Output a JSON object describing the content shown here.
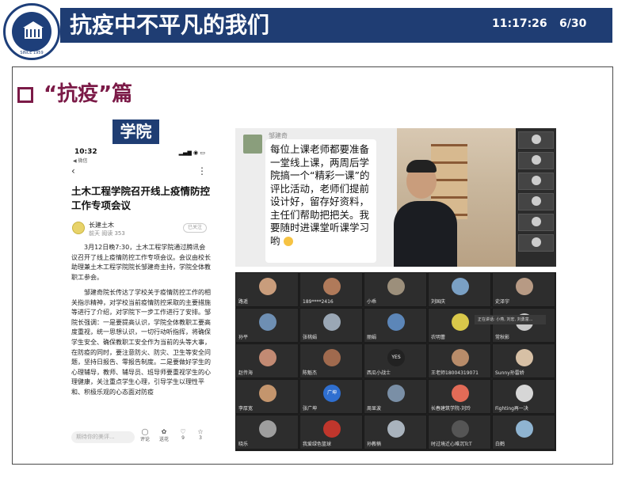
{
  "header": {
    "title": "抗疫中不平凡的我们",
    "time": "11:17:26",
    "page": "6/30"
  },
  "logo": {
    "label": "SINCE 1959"
  },
  "section": {
    "title": "“抗疫”篇"
  },
  "tag": {
    "label": "学院"
  },
  "phone": {
    "time": "10:32",
    "carrier": "◀ 微信",
    "back": "‹",
    "more": "⋮",
    "article_title": "土木工程学院召开线上疫情防控工作专项会议",
    "account_name": "长建土木",
    "account_meta": "前天  阅读 353",
    "follow_label": "已关注",
    "paragraph1": "3月12日晚7:30，土木工程学院通过腾讯会议召开了线上疫情防控工作专项会议。会议由校长助理兼土木工程学院院长邹建奇主持，学院全体教职工参会。",
    "paragraph2": "邹建奇院长传达了学校关于疫情防控工作的相关指示精神，对学校当前疫情防控采取的主要措施等进行了介绍，对学院下一步工作进行了安排。邹院长强调：一是要提高认识，学院全体教职工要高度重视，统一思想认识，一切行动听指挥，将确保学生安全、确保教职工安全作为当前的头等大事，在防疫的同时，要注意防火、防灾、卫生等安全问题，坚持日报告、零报告制度。二是要做好学生的心理辅导，教师、辅导员、班导师要重视学生的心理健康，关注重点学生心理，引导学生以理性平和、积极乐观的心态面对防疫",
    "comment_placeholder": "期待你的美评...",
    "actions": [
      {
        "icon": "◯",
        "label": "评论"
      },
      {
        "icon": "✿",
        "label": "送花"
      },
      {
        "icon": "♡",
        "label": "9"
      },
      {
        "icon": "☆",
        "label": "3"
      }
    ]
  },
  "chat": {
    "sender": "邹建奇",
    "message": "每位上课老师都要准备一堂线上课，两周后学院搞一个“精彩一课”的评比活动，老师们提前设计好，留存好资料，主任们帮助把把关。我要随时进课堂听课学习哟"
  },
  "meeting": {
    "popup": "正在讲话: 小燕, 刘宏, 刘勇富...",
    "participants": [
      {
        "name": "路遥",
        "avatar": "#c99d7c",
        "label": ""
      },
      {
        "name": "189****2416",
        "avatar": "#b07a5a",
        "label": ""
      },
      {
        "name": "小乖",
        "avatar": "#9c8f7b",
        "label": ""
      },
      {
        "name": "刘国庆",
        "avatar": "#7aa0c4",
        "label": ""
      },
      {
        "name": "史泽宇",
        "avatar": "#b79a84",
        "label": ""
      },
      {
        "name": "孙平",
        "avatar": "#6e8fb3",
        "label": ""
      },
      {
        "name": "张桃娟",
        "avatar": "#9aa7b5",
        "label": ""
      },
      {
        "name": "丽娟",
        "avatar": "#5c86b8",
        "label": ""
      },
      {
        "name": "农明蕾",
        "avatar": "#d9c84a",
        "label": ""
      },
      {
        "name": "常秋影",
        "avatar": "#c9c9c9",
        "label": ""
      },
      {
        "name": "赵传海",
        "avatar": "#c28a73",
        "label": ""
      },
      {
        "name": "陈魁杰",
        "avatar": "#a06a4e",
        "label": ""
      },
      {
        "name": "西瓜小战士",
        "avatar": "#222222",
        "label": "YES"
      },
      {
        "name": "王老师18004319071",
        "avatar": "#b88c6a",
        "label": ""
      },
      {
        "name": "Sunny孙雷娇",
        "avatar": "#d7c0a5",
        "label": ""
      },
      {
        "name": "李厚宽",
        "avatar": "#c4956d",
        "label": ""
      },
      {
        "name": "张广坤",
        "avatar": "#2f6fd0",
        "label": "广坤"
      },
      {
        "name": "周显波",
        "avatar": "#7a8fa6",
        "label": ""
      },
      {
        "name": "长春建筑学院-刘玲",
        "avatar": "#e26b57",
        "label": ""
      },
      {
        "name": "Fighting再一决",
        "avatar": "#d6d6d6",
        "label": ""
      },
      {
        "name": "晓乐",
        "avatar": "#9e9e9e",
        "label": ""
      },
      {
        "name": "我爱绿色篮球",
        "avatar": "#c0362c",
        "label": ""
      },
      {
        "name": "孙教楠",
        "avatar": "#a9b3bd",
        "label": ""
      },
      {
        "name": "时过境迁心难沉TcT",
        "avatar": "#555555",
        "label": ""
      },
      {
        "name": "白鹤",
        "avatar": "#8fb4d1",
        "label": ""
      }
    ]
  },
  "colors": {
    "brand_blue": "#1f3d73",
    "section_maroon": "#7b1a47"
  }
}
